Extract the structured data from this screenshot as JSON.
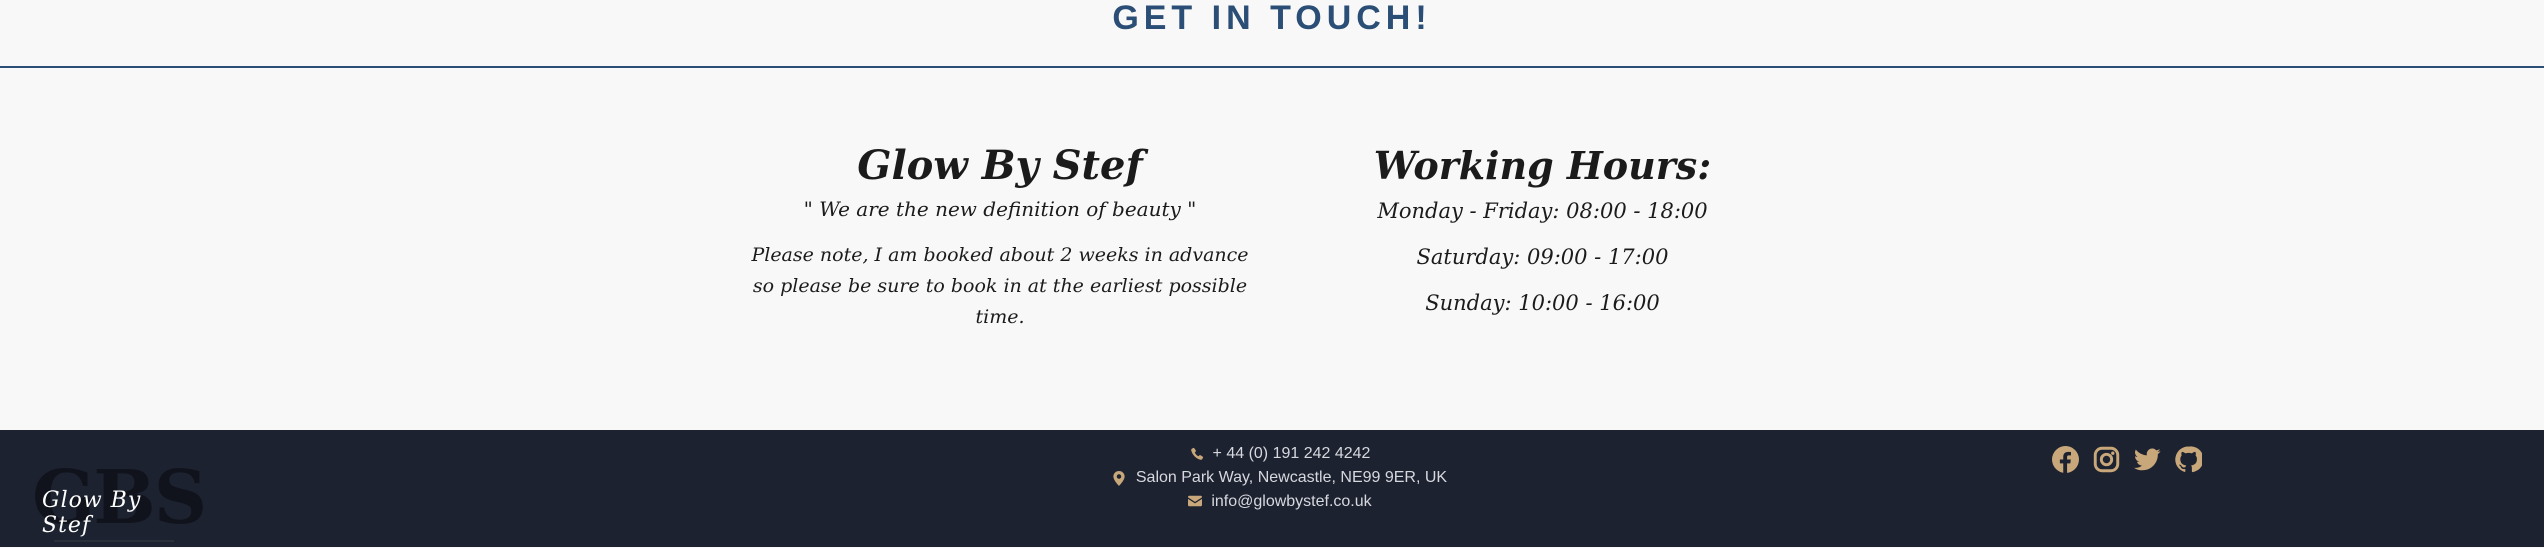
{
  "contact_section": {
    "heading": "GET IN TOUCH!"
  },
  "about": {
    "brand": "Glow By Stef",
    "tagline": "\" We are the new definition of beauty \"",
    "note": "Please note, I am booked about 2 weeks in advance so please be sure to book in at the earliest possible time."
  },
  "hours": {
    "title": "Working Hours:",
    "lines": [
      "Monday - Friday: 08:00 - 18:00",
      "Saturday: 09:00 - 17:00",
      "Sunday: 10:00 - 16:00"
    ]
  },
  "footer": {
    "logo": {
      "letters": "GBS",
      "script": "Glow By Stef"
    },
    "phone": "+ 44 (0) 191 242 4242",
    "address": "Salon Park Way, Newcastle, NE99 9ER, UK",
    "email": "info@glowbystef.co.uk",
    "icons": {
      "phone": "phone-icon",
      "address": "location-pin-icon",
      "email": "envelope-icon",
      "social": [
        "facebook-icon",
        "instagram-icon",
        "twitter-icon",
        "github-icon"
      ]
    },
    "colors": {
      "background": "#1d2230",
      "accent": "#c8a77a",
      "text": "#d6d8de"
    }
  }
}
